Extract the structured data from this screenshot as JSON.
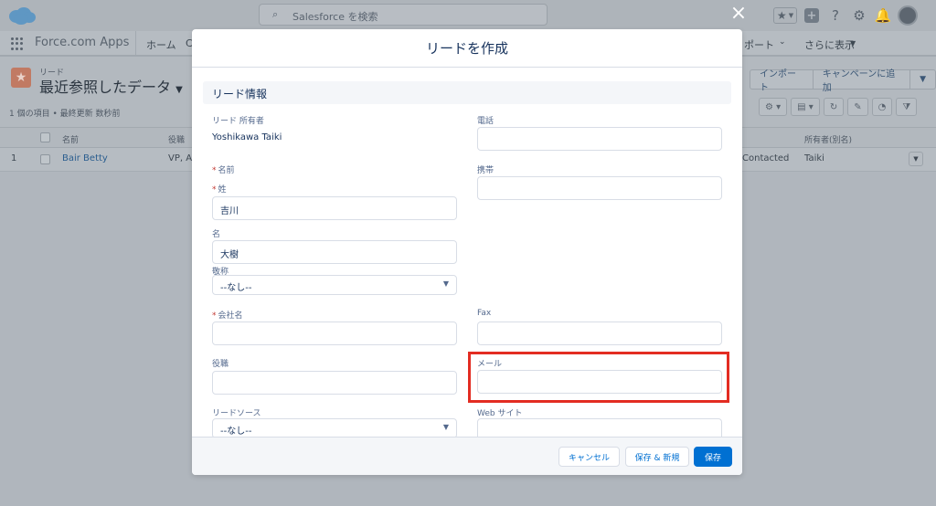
{
  "colors": {
    "brand": "#0070d2",
    "highlight": "#e32c22",
    "lead_icon": "#c17a63",
    "required": "#c23934"
  },
  "topbar": {
    "search_placeholder": "Salesforce を検索",
    "icons": [
      "salesforce-logo-icon",
      "search-icon",
      "star-icon",
      "plus-icon",
      "help-icon",
      "gear-icon",
      "bell-icon",
      "avatar"
    ]
  },
  "nav": {
    "app_name": "Force.com Apps",
    "items": [
      "ホーム",
      "C",
      "ポート",
      "さらに表示"
    ]
  },
  "list": {
    "object_label": "リード",
    "view_title": "最近参照したデータ",
    "meta": "1 個の項目 • 最終更新 数秒前",
    "actions": [
      "インポート",
      "キャンペーンに追加"
    ],
    "columns": [
      "名前",
      "役職",
      "所有者(別名)"
    ],
    "rows": [
      {
        "num": "1",
        "name": "Bair Betty",
        "title": "VP, Ac",
        "status": "Contacted",
        "owner": "Taiki"
      }
    ]
  },
  "modal": {
    "close_label": "×",
    "title": "リードを作成",
    "section_title": "リード情報",
    "owner_label": "リード 所有者",
    "owner_value": "Yoshikawa Taiki",
    "name_label": "名前",
    "last_name_label": "姓",
    "last_name_value": "吉川",
    "first_name_label": "名",
    "first_name_value": "大樹",
    "salutation_label": "敬称",
    "salutation_value": "--なし--",
    "company_label": "会社名",
    "title_label": "役職",
    "lead_source_label": "リードソース",
    "lead_source_value": "--なし--",
    "phone_label": "電話",
    "mobile_label": "携帯",
    "fax_label": "Fax",
    "email_label": "メール",
    "website_label": "Web サイト",
    "buttons": {
      "cancel": "キャンセル",
      "save_new": "保存 & 新規",
      "save": "保存"
    }
  }
}
